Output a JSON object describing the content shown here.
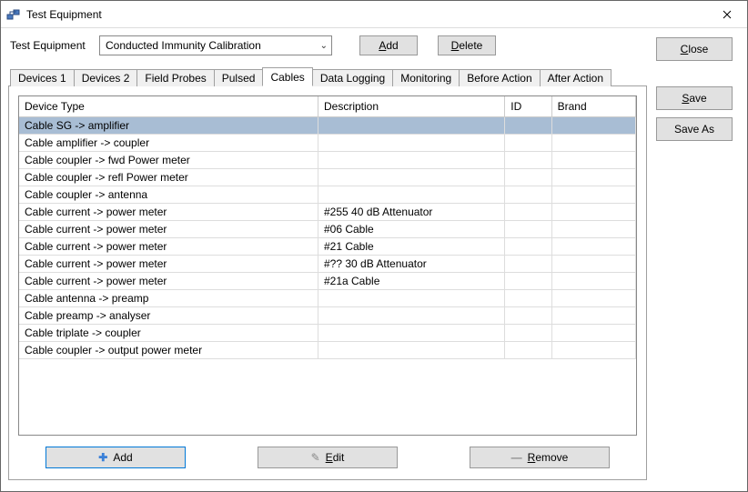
{
  "window": {
    "title": "Test Equipment"
  },
  "toprow": {
    "label": "Test Equipment",
    "selected": "Conducted Immunity Calibration",
    "add": "Add",
    "delete": "Delete"
  },
  "tabs": [
    {
      "label": "Devices 1"
    },
    {
      "label": "Devices 2"
    },
    {
      "label": "Field Probes"
    },
    {
      "label": "Pulsed"
    },
    {
      "label": "Cables"
    },
    {
      "label": "Data Logging"
    },
    {
      "label": "Monitoring"
    },
    {
      "label": "Before Action"
    },
    {
      "label": "After Action"
    }
  ],
  "active_tab": 4,
  "grid": {
    "columns": [
      {
        "label": "Device Type",
        "width": "320"
      },
      {
        "label": "Description",
        "width": "200"
      },
      {
        "label": "ID",
        "width": "50"
      },
      {
        "label": "Brand",
        "width": "90"
      }
    ],
    "rows": [
      {
        "device": "Cable SG -> amplifier",
        "desc": "",
        "id": "",
        "brand": "",
        "selected": true
      },
      {
        "device": "Cable amplifier -> coupler",
        "desc": "",
        "id": "",
        "brand": ""
      },
      {
        "device": "Cable coupler -> fwd Power meter",
        "desc": "",
        "id": "",
        "brand": ""
      },
      {
        "device": "Cable coupler -> refl Power meter",
        "desc": "",
        "id": "",
        "brand": ""
      },
      {
        "device": "Cable coupler -> antenna",
        "desc": "",
        "id": "",
        "brand": ""
      },
      {
        "device": "Cable current -> power meter",
        "desc": "#255 40 dB Attenuator",
        "id": "",
        "brand": ""
      },
      {
        "device": "Cable current -> power meter",
        "desc": "#06 Cable",
        "id": "",
        "brand": ""
      },
      {
        "device": "Cable current -> power meter",
        "desc": "#21 Cable",
        "id": "",
        "brand": ""
      },
      {
        "device": "Cable current -> power meter",
        "desc": "#?? 30 dB Attenuator",
        "id": "",
        "brand": ""
      },
      {
        "device": "Cable current -> power meter",
        "desc": "#21a Cable",
        "id": "",
        "brand": ""
      },
      {
        "device": "Cable antenna -> preamp",
        "desc": "",
        "id": "",
        "brand": ""
      },
      {
        "device": "Cable preamp -> analyser",
        "desc": "",
        "id": "",
        "brand": ""
      },
      {
        "device": "Cable triplate -> coupler",
        "desc": "",
        "id": "",
        "brand": ""
      },
      {
        "device": "Cable coupler -> output power meter",
        "desc": "",
        "id": "",
        "brand": ""
      }
    ]
  },
  "panel_buttons": {
    "add": "Add",
    "edit": "Edit",
    "remove": "Remove"
  },
  "sidebar": {
    "close": "Close",
    "save": "Save",
    "saveas": "Save As"
  }
}
